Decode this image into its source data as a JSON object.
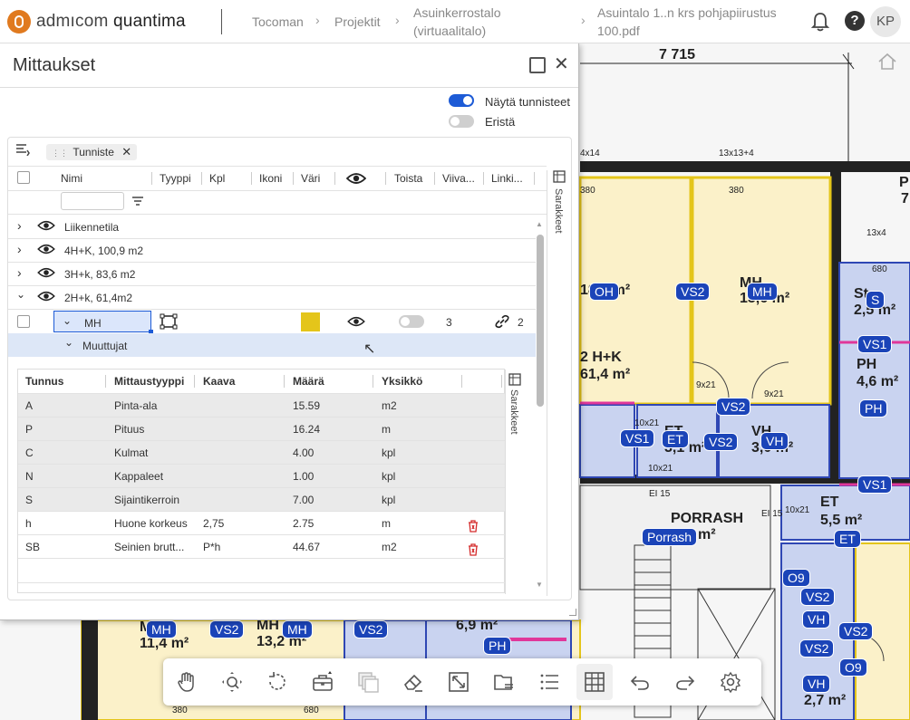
{
  "app": {
    "brand_left": "admıcom",
    "brand_right": "quantima"
  },
  "breadcrumbs": [
    {
      "label": "Tocoman"
    },
    {
      "label": "Projektit"
    },
    {
      "label": "Asuinkerrostalo\n(virtuaalitalo)"
    },
    {
      "label": "Asuintalo 1..n krs pohjapiirustus\n100.pdf"
    }
  ],
  "topbar": {
    "avatar_initials": "KP",
    "bell_icon": "bell-icon",
    "help_icon": "help-icon",
    "help_text": "?"
  },
  "panel": {
    "title": "Mittaukset",
    "show_labels": {
      "label": "Näytä tunnisteet",
      "on": true
    },
    "isolate": {
      "label": "Eristä",
      "on": false
    },
    "group_chip": "Tunniste",
    "columns": [
      "Nimi",
      "Tyyppi",
      "Kpl",
      "Ikoni",
      "Väri",
      "Toista",
      "Viiva...",
      "Linki..."
    ],
    "side_tab_label": "Sarakkeet",
    "groups": [
      {
        "label": "Liikennetila",
        "expanded": false
      },
      {
        "label": "4H+K, 100,9 m2",
        "expanded": false
      },
      {
        "label": "3H+k, 83,6 m2",
        "expanded": false
      },
      {
        "label": "2H+k, 61,4m2",
        "expanded": true
      }
    ],
    "item": {
      "name": "MH",
      "color": "#e4c51a",
      "line_width": "3",
      "link_count": "2"
    },
    "variables_label": "Muuttujat",
    "variables": {
      "columns": [
        "Tunnus",
        "Mittaustyyppi",
        "Kaava",
        "Määrä",
        "Yksikkö"
      ],
      "side_tab_label": "Sarakkeet",
      "rows": [
        {
          "code": "A",
          "type": "Pinta-ala",
          "formula": "",
          "value": "15.59",
          "unit": "m2",
          "readonly": true
        },
        {
          "code": "P",
          "type": "Pituus",
          "formula": "",
          "value": "16.24",
          "unit": "m",
          "readonly": true
        },
        {
          "code": "C",
          "type": "Kulmat",
          "formula": "",
          "value": "4.00",
          "unit": "kpl",
          "readonly": true
        },
        {
          "code": "N",
          "type": "Kappaleet",
          "formula": "",
          "value": "1.00",
          "unit": "kpl",
          "readonly": true
        },
        {
          "code": "S",
          "type": "Sijaintikerroin",
          "formula": "",
          "value": "7.00",
          "unit": "kpl",
          "readonly": true
        },
        {
          "code": "h",
          "type": "Huone korkeus",
          "formula": "2,75",
          "value": "2.75",
          "unit": "m",
          "readonly": false
        },
        {
          "code": "SB",
          "type": "Seinien brutt...",
          "formula": "P*h",
          "value": "44.67",
          "unit": "m2",
          "readonly": false
        }
      ]
    }
  },
  "plan": {
    "dimension_top": "7 715",
    "rooms": [
      {
        "name": "OH",
        "area_line1": "18,5 m²"
      },
      {
        "name": "MH",
        "area_line1": "15,6 m²"
      },
      {
        "name": "2 H+K",
        "area_line1": "61,4 m²"
      },
      {
        "name": "PH",
        "area_line1": "4,6 m²"
      },
      {
        "name": "ET",
        "area_line1": "5,5 m²"
      },
      {
        "name": "PORRASH",
        "area_line1": "m²"
      },
      {
        "name": "MH",
        "area_line1": "11,4 m²"
      },
      {
        "name": "MH",
        "area_line1": "13,2 m²"
      },
      {
        "name": "6,9 m²",
        "area_line1": ""
      },
      {
        "name": "2,7 m²",
        "area_line1": ""
      },
      {
        "name": "VH",
        "area_line1": "3,0 m²"
      },
      {
        "name": "ET",
        "area_line1": "3,1 m²"
      },
      {
        "name": "St",
        "area_line1": "2,5 m²"
      },
      {
        "name": "P",
        "area_line1": "7"
      }
    ],
    "badges": [
      "OH",
      "VS2",
      "MH",
      "S",
      "VS1",
      "PH",
      "VS2",
      "VS1",
      "ET",
      "VS2",
      "VH",
      "VS1",
      "ET",
      "Porrash",
      "O9",
      "VS2",
      "VH",
      "VS2",
      "VS2",
      "O9",
      "VH",
      "MH",
      "VS2",
      "MH",
      "VS2",
      "PH"
    ],
    "small_labels": [
      "4x14",
      "13x13+4",
      "380",
      "380",
      "13x4",
      "680",
      "10x21",
      "EI 15",
      "EI 15",
      "9x21",
      "9x21",
      "10x21",
      "10x21",
      "380",
      "680"
    ]
  },
  "toolbar": {
    "tools": [
      "pan-tool",
      "zoom-fit-tool",
      "rotate-tool",
      "toolbox-tool",
      "layers-tool",
      "eraser-tool",
      "fullscreen-tool",
      "folder-tool",
      "list-tool",
      "table-tool",
      "undo-tool",
      "redo-tool",
      "settings-tool"
    ],
    "active": "table-tool"
  }
}
